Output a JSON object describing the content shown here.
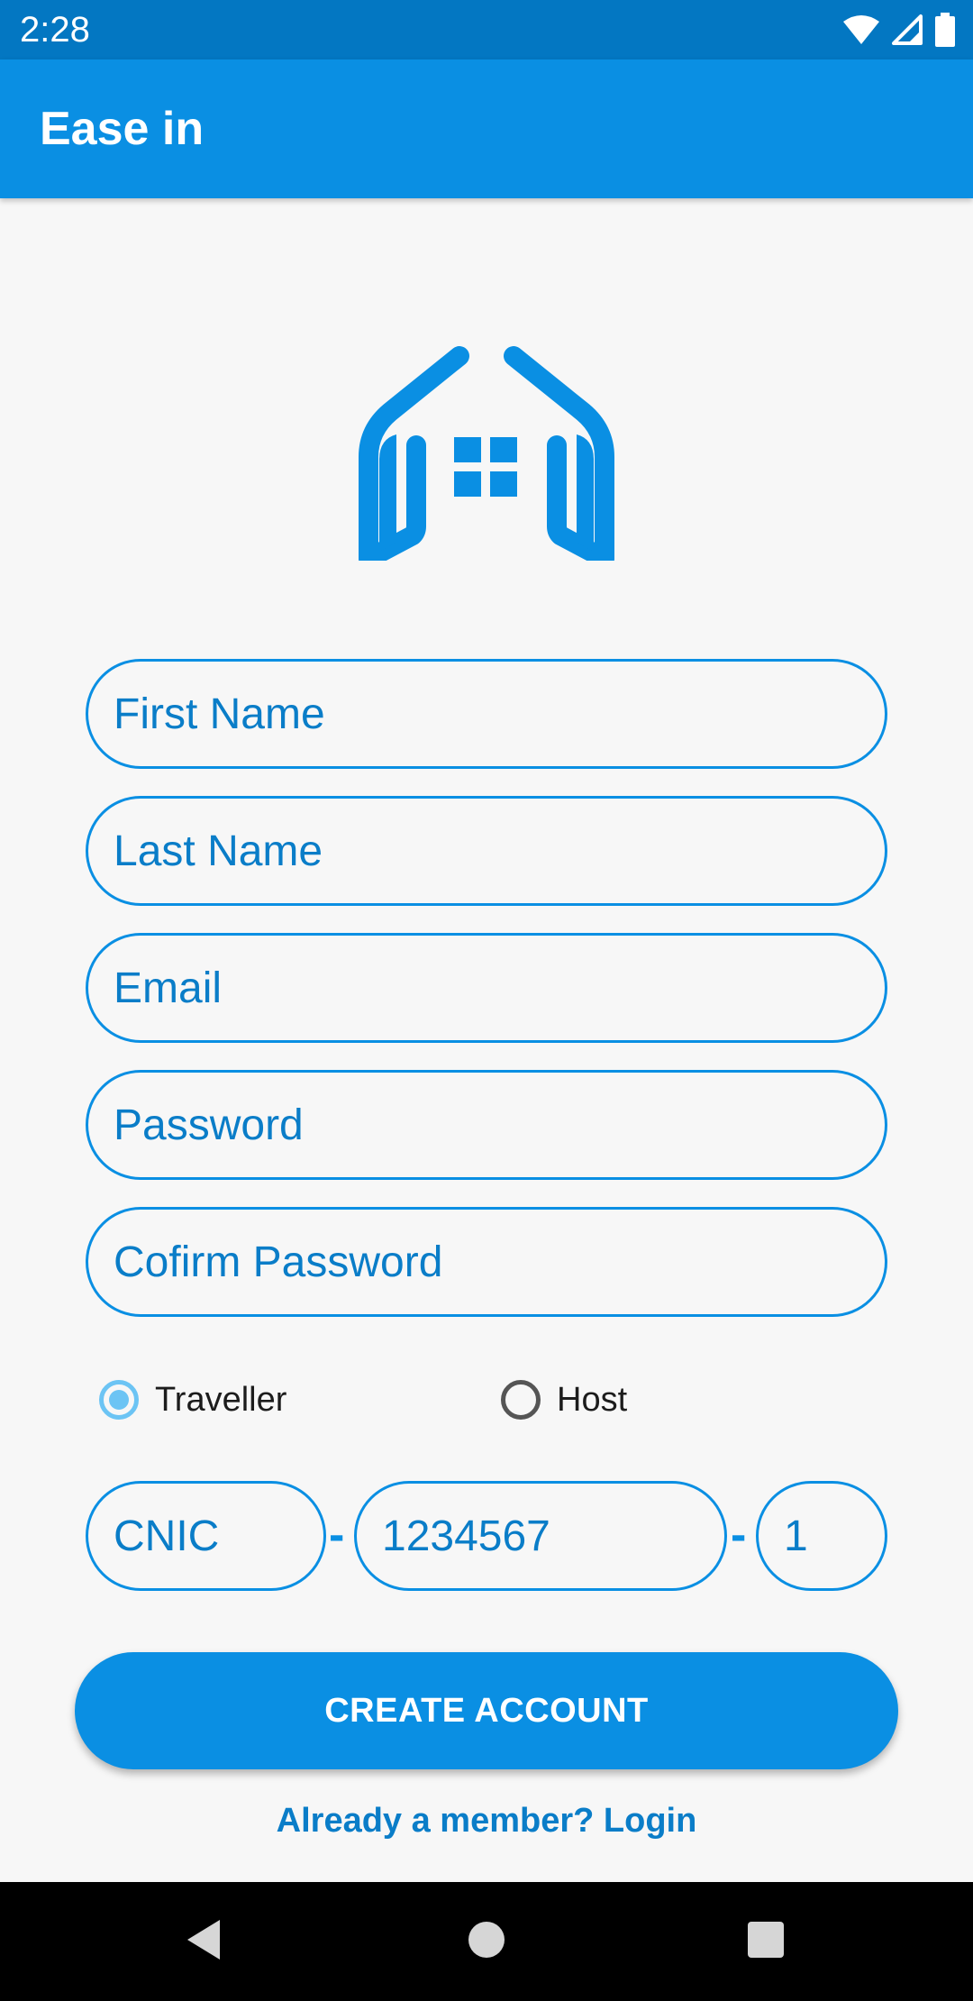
{
  "status_bar": {
    "time": "2:28",
    "icons": [
      "wifi-icon",
      "cellular-signal-icon",
      "battery-icon"
    ]
  },
  "app_bar": {
    "title": "Ease in"
  },
  "logo": {
    "icon": "house-logo-icon"
  },
  "form": {
    "first_name": {
      "placeholder": "First Name",
      "value": ""
    },
    "last_name": {
      "placeholder": "Last Name",
      "value": ""
    },
    "email": {
      "placeholder": "Email",
      "value": ""
    },
    "password": {
      "placeholder": "Password",
      "value": ""
    },
    "confirm_password": {
      "placeholder": "Cofirm Password",
      "value": ""
    },
    "role": {
      "options": [
        {
          "label": "Traveller",
          "checked": true
        },
        {
          "label": "Host",
          "checked": false
        }
      ]
    },
    "cnic": {
      "part1": {
        "placeholder": "CNIC",
        "value": ""
      },
      "separator": "-",
      "part2": {
        "placeholder": "1234567",
        "value": ""
      },
      "part3": {
        "placeholder": "1",
        "value": ""
      }
    },
    "submit_label": "CREATE ACCOUNT",
    "login_link": "Already a member? Login"
  },
  "nav_bar": {
    "buttons": [
      "back-icon",
      "home-icon",
      "recents-icon"
    ]
  },
  "colors": {
    "status_bar": "#0377C2",
    "primary": "#0A8FE3",
    "field_text": "#0A7DC8",
    "radio_checked": "#6CC4F4",
    "background": "#F7F7F7"
  }
}
